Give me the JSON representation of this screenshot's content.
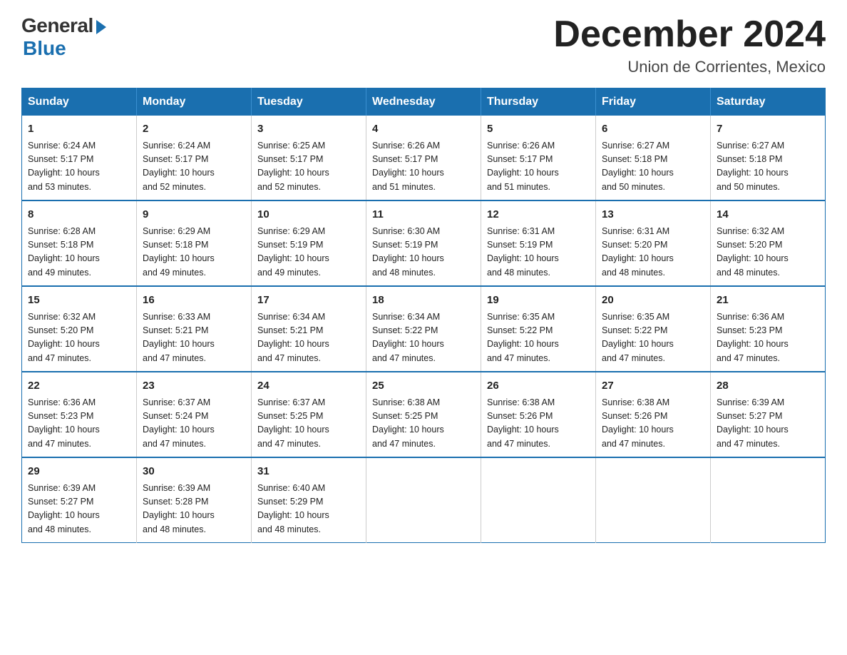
{
  "logo": {
    "general": "General",
    "blue": "Blue"
  },
  "header": {
    "month": "December 2024",
    "location": "Union de Corrientes, Mexico"
  },
  "weekdays": [
    "Sunday",
    "Monday",
    "Tuesday",
    "Wednesday",
    "Thursday",
    "Friday",
    "Saturday"
  ],
  "weeks": [
    [
      {
        "day": "1",
        "sunrise": "6:24 AM",
        "sunset": "5:17 PM",
        "daylight": "10 hours and 53 minutes."
      },
      {
        "day": "2",
        "sunrise": "6:24 AM",
        "sunset": "5:17 PM",
        "daylight": "10 hours and 52 minutes."
      },
      {
        "day": "3",
        "sunrise": "6:25 AM",
        "sunset": "5:17 PM",
        "daylight": "10 hours and 52 minutes."
      },
      {
        "day": "4",
        "sunrise": "6:26 AM",
        "sunset": "5:17 PM",
        "daylight": "10 hours and 51 minutes."
      },
      {
        "day": "5",
        "sunrise": "6:26 AM",
        "sunset": "5:17 PM",
        "daylight": "10 hours and 51 minutes."
      },
      {
        "day": "6",
        "sunrise": "6:27 AM",
        "sunset": "5:18 PM",
        "daylight": "10 hours and 50 minutes."
      },
      {
        "day": "7",
        "sunrise": "6:27 AM",
        "sunset": "5:18 PM",
        "daylight": "10 hours and 50 minutes."
      }
    ],
    [
      {
        "day": "8",
        "sunrise": "6:28 AM",
        "sunset": "5:18 PM",
        "daylight": "10 hours and 49 minutes."
      },
      {
        "day": "9",
        "sunrise": "6:29 AM",
        "sunset": "5:18 PM",
        "daylight": "10 hours and 49 minutes."
      },
      {
        "day": "10",
        "sunrise": "6:29 AM",
        "sunset": "5:19 PM",
        "daylight": "10 hours and 49 minutes."
      },
      {
        "day": "11",
        "sunrise": "6:30 AM",
        "sunset": "5:19 PM",
        "daylight": "10 hours and 48 minutes."
      },
      {
        "day": "12",
        "sunrise": "6:31 AM",
        "sunset": "5:19 PM",
        "daylight": "10 hours and 48 minutes."
      },
      {
        "day": "13",
        "sunrise": "6:31 AM",
        "sunset": "5:20 PM",
        "daylight": "10 hours and 48 minutes."
      },
      {
        "day": "14",
        "sunrise": "6:32 AM",
        "sunset": "5:20 PM",
        "daylight": "10 hours and 48 minutes."
      }
    ],
    [
      {
        "day": "15",
        "sunrise": "6:32 AM",
        "sunset": "5:20 PM",
        "daylight": "10 hours and 47 minutes."
      },
      {
        "day": "16",
        "sunrise": "6:33 AM",
        "sunset": "5:21 PM",
        "daylight": "10 hours and 47 minutes."
      },
      {
        "day": "17",
        "sunrise": "6:34 AM",
        "sunset": "5:21 PM",
        "daylight": "10 hours and 47 minutes."
      },
      {
        "day": "18",
        "sunrise": "6:34 AM",
        "sunset": "5:22 PM",
        "daylight": "10 hours and 47 minutes."
      },
      {
        "day": "19",
        "sunrise": "6:35 AM",
        "sunset": "5:22 PM",
        "daylight": "10 hours and 47 minutes."
      },
      {
        "day": "20",
        "sunrise": "6:35 AM",
        "sunset": "5:22 PM",
        "daylight": "10 hours and 47 minutes."
      },
      {
        "day": "21",
        "sunrise": "6:36 AM",
        "sunset": "5:23 PM",
        "daylight": "10 hours and 47 minutes."
      }
    ],
    [
      {
        "day": "22",
        "sunrise": "6:36 AM",
        "sunset": "5:23 PM",
        "daylight": "10 hours and 47 minutes."
      },
      {
        "day": "23",
        "sunrise": "6:37 AM",
        "sunset": "5:24 PM",
        "daylight": "10 hours and 47 minutes."
      },
      {
        "day": "24",
        "sunrise": "6:37 AM",
        "sunset": "5:25 PM",
        "daylight": "10 hours and 47 minutes."
      },
      {
        "day": "25",
        "sunrise": "6:38 AM",
        "sunset": "5:25 PM",
        "daylight": "10 hours and 47 minutes."
      },
      {
        "day": "26",
        "sunrise": "6:38 AM",
        "sunset": "5:26 PM",
        "daylight": "10 hours and 47 minutes."
      },
      {
        "day": "27",
        "sunrise": "6:38 AM",
        "sunset": "5:26 PM",
        "daylight": "10 hours and 47 minutes."
      },
      {
        "day": "28",
        "sunrise": "6:39 AM",
        "sunset": "5:27 PM",
        "daylight": "10 hours and 47 minutes."
      }
    ],
    [
      {
        "day": "29",
        "sunrise": "6:39 AM",
        "sunset": "5:27 PM",
        "daylight": "10 hours and 48 minutes."
      },
      {
        "day": "30",
        "sunrise": "6:39 AM",
        "sunset": "5:28 PM",
        "daylight": "10 hours and 48 minutes."
      },
      {
        "day": "31",
        "sunrise": "6:40 AM",
        "sunset": "5:29 PM",
        "daylight": "10 hours and 48 minutes."
      },
      null,
      null,
      null,
      null
    ]
  ],
  "labels": {
    "sunrise": "Sunrise:",
    "sunset": "Sunset:",
    "daylight": "Daylight:"
  }
}
